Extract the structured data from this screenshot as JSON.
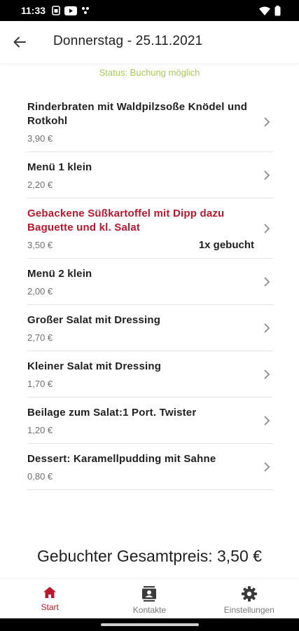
{
  "status_bar": {
    "time": "11:33",
    "icons_left": [
      "sim-icon",
      "youtube-icon",
      "dots-icon"
    ],
    "icons_right": [
      "wifi-icon",
      "battery-icon"
    ]
  },
  "header": {
    "title": "Donnerstag - 25.11.2021",
    "back_icon": "arrow-back-icon"
  },
  "status": {
    "text": "Status: Buchung möglich",
    "color": "#a5c95b"
  },
  "menu_items": [
    {
      "name": "Rinderbraten mit Waldpilzsoße Knödel und Rotkohl",
      "price": "3,90 €",
      "booked_label": ""
    },
    {
      "name": "Menü 1 klein",
      "price": "2,20 €",
      "booked_label": ""
    },
    {
      "name": "Gebackene Süßkartoffel mit Dipp dazu Baguette und kl. Salat",
      "price": "3,50 €",
      "booked_label": "1x gebucht"
    },
    {
      "name": "Menü 2 klein",
      "price": "2,00 €",
      "booked_label": ""
    },
    {
      "name": "Großer Salat mit Dressing",
      "price": "2,70 €",
      "booked_label": ""
    },
    {
      "name": "Kleiner Salat mit Dressing",
      "price": "1,70 €",
      "booked_label": ""
    },
    {
      "name": "Beilage zum Salat:1 Port. Twister",
      "price": "1,20 €",
      "booked_label": ""
    },
    {
      "name": "Dessert: Karamellpudding mit Sahne",
      "price": "0,80 €",
      "booked_label": ""
    }
  ],
  "total": {
    "text": "Gebuchter Gesamtpreis: 3,50 €"
  },
  "bottom_nav": {
    "items": [
      {
        "label": "Start",
        "icon": "home-icon",
        "active": true
      },
      {
        "label": "Kontakte",
        "icon": "contacts-icon",
        "active": false
      },
      {
        "label": "Einstellungen",
        "icon": "gear-icon",
        "active": false
      }
    ]
  },
  "colors": {
    "accent": "#b8192c",
    "status_ok": "#a5c95b",
    "text": "#1f1f1f",
    "muted": "#6f6f6f"
  }
}
